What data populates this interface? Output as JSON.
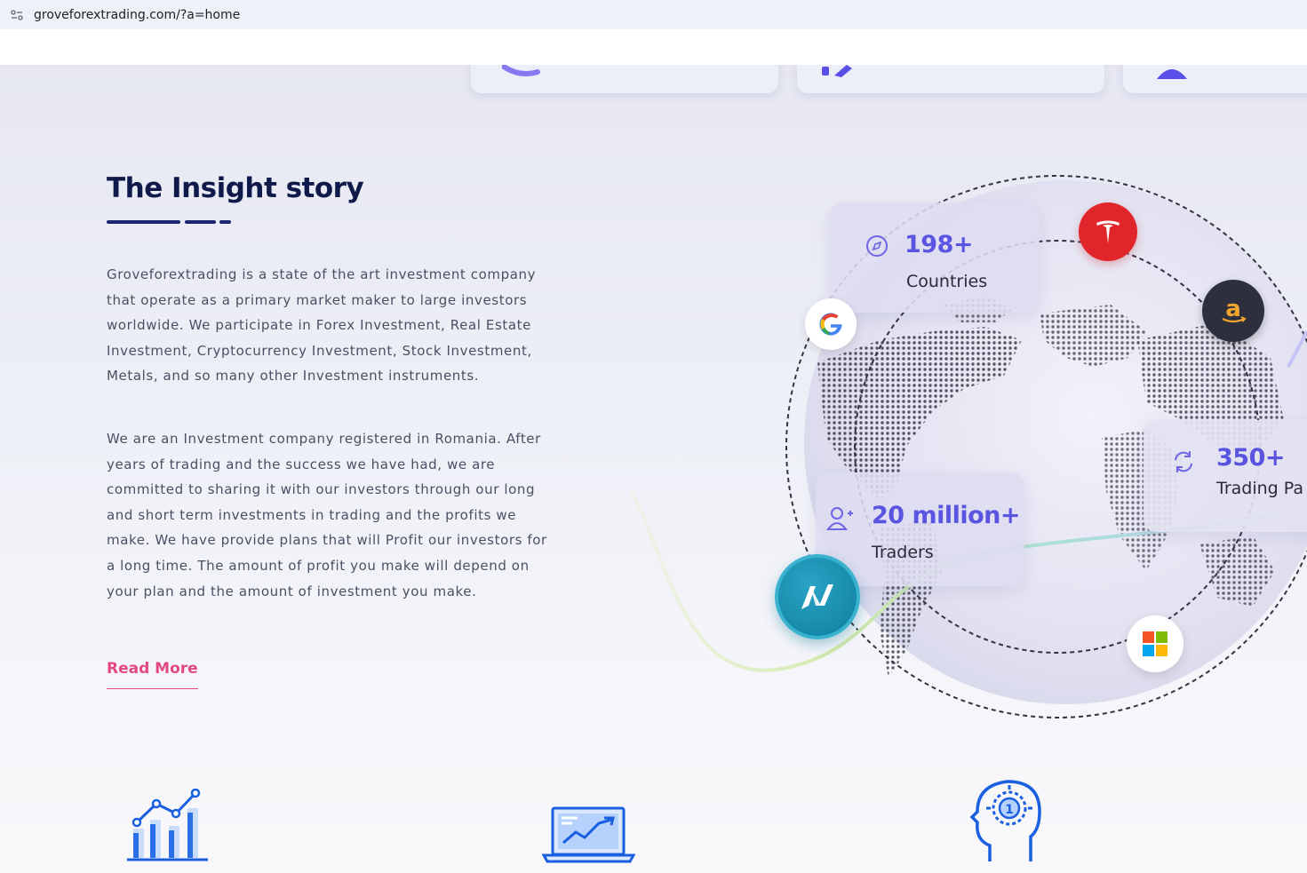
{
  "browser": {
    "url": "groveforextrading.com/?a=home"
  },
  "section": {
    "title": "The Insight story",
    "paragraph1": "Groveforextrading is a state of the art investment company that operate as a primary market maker to large investors worldwide. We participate in Forex Investment, Real Estate Investment, Cryptocurrency Investment, Stock Investment, Metals, and so many other Investment instruments.",
    "paragraph2": "We are an Investment company registered in Romania. After years of trading and the success we have had, we are committed to sharing it with our investors through our long and short term investments in trading and the profits we make. We have provide plans that will Profit our investors for a long time. The amount of profit you make will depend on your plan and the amount of investment you make.",
    "read_more": "Read More"
  },
  "stats": [
    {
      "number": "198+",
      "label": "Countries",
      "icon": "compass-icon"
    },
    {
      "number": "20 million+",
      "label": "Traders",
      "icon": "user-add-icon"
    },
    {
      "number": "350+",
      "label": "Trading Pa",
      "icon": "refresh-icon"
    }
  ],
  "brands": [
    {
      "name": "tesla",
      "icon": "tesla-logo"
    },
    {
      "name": "amazon",
      "icon": "amazon-logo"
    },
    {
      "name": "google",
      "icon": "google-logo"
    },
    {
      "name": "microsoft",
      "icon": "microsoft-logo"
    },
    {
      "name": "nasdaq",
      "icon": "nasdaq-logo"
    }
  ],
  "features": [
    {
      "icon": "bar-chart-icon"
    },
    {
      "icon": "laptop-chart-icon"
    },
    {
      "icon": "head-idea-icon"
    }
  ],
  "colors": {
    "title": "#0f1a4a",
    "accent_pink": "#e2497e",
    "stat_number": "#5a55e0",
    "icon_blue": "#1a5fe0"
  }
}
